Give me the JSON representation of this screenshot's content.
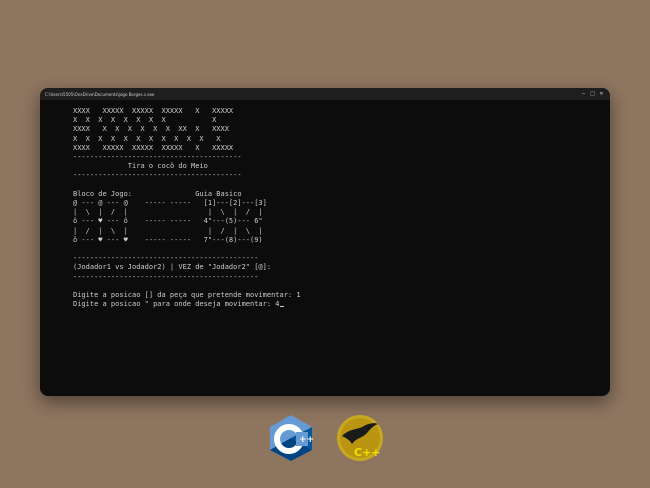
{
  "window": {
    "title": "C:\\Users\\5505\\OneDrive\\Documents\\jogo Borges.c.exe",
    "controls": {
      "minimize": "─",
      "maximize": "□",
      "close": "✕"
    }
  },
  "console": {
    "banner": [
      "XXXX   XXXXX  XXXXX  XXXXX   X   XXXXX",
      "X  X  X  X  X  X  X  X           X",
      "XXXX   X  X  X  X  X  X  XX  X   XXXX",
      "X  X  X  X  X  X  X  X  X  X  X   X",
      "XXXX   XXXXX  XXXXX  XXXXX   X   XXXXX"
    ],
    "separator_short": "----------------------------------------",
    "game_title": "Tira o cocô do Meio",
    "board_header": "Bloco de Jogo:               Guia Basico",
    "board_rows": [
      "@ --- @ --- @    ----- -----   [1]---[2]---[3]",
      "|  \\  |  /  |                   |  \\  |  /  |",
      "ô --- ♥ --- ô    ----- -----   4\"---(5)--- 6\"",
      "|  /  |  \\  |                   |  /  |  \\  |",
      "ô --- ♥ --- ♥    ----- -----   7\"---(8)---(9)"
    ],
    "separator_long": "--------------------------------------------",
    "turn_info": "(Jodador1 vs Jodador2) | VEZ de \"Jodador2\" [@]:",
    "prompt_piece": "Digite a posicao [] da peça que pretende movimentar: 1",
    "prompt_move": "Digite a posicao \" para onde deseja movimentar: 4"
  },
  "logos": {
    "cpp_logo": {
      "text": "C",
      "suffix": "++",
      "color_main": "#659ad2",
      "color_dark": "#004482"
    },
    "compiler_logo": {
      "text": "C++",
      "color_bg": "#c8a820",
      "color_text": "#e6d000"
    }
  }
}
